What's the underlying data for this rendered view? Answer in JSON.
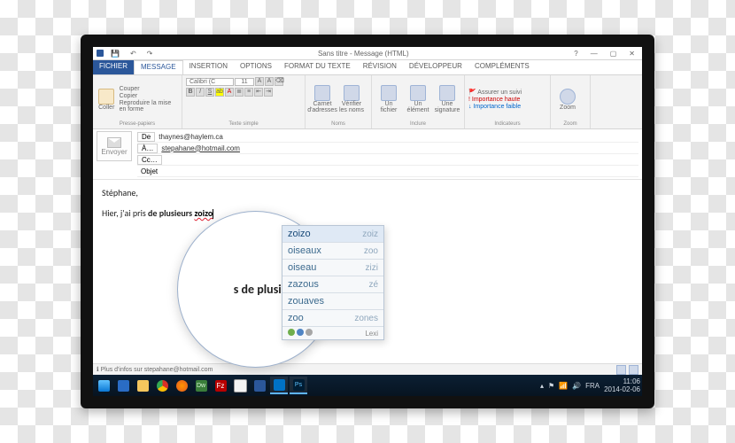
{
  "window": {
    "title": "Sans titre - Message (HTML)"
  },
  "ribbon": {
    "file": "FICHIER",
    "tabs": [
      "MESSAGE",
      "INSERTION",
      "OPTIONS",
      "FORMAT DU TEXTE",
      "RÉVISION",
      "DÉVELOPPEUR",
      "COMPLÉMENTS"
    ],
    "clipboard": {
      "paste": "Coller",
      "cut": "Couper",
      "copy": "Copier",
      "fmt": "Reproduire la mise en forme",
      "title": "Presse-papiers"
    },
    "font": {
      "name": "Calibri (C",
      "size": "11",
      "title": "Texte simple"
    },
    "names": {
      "addressbook": "Carnet\nd'adresses",
      "check": "Vérifier\nles noms",
      "title": "Noms"
    },
    "include": {
      "file": "Un\nfichier",
      "item": "Un\nélément",
      "sig": "Une\nsignature",
      "title": "Inclure"
    },
    "flags": {
      "follow": "Assurer un suivi",
      "high": "Importance haute",
      "low": "Importance faible",
      "title": "Indicateurs"
    },
    "zoom": {
      "label": "Zoom",
      "title": "Zoom"
    }
  },
  "headers": {
    "send": "Envoyer",
    "from_btn": "De",
    "from_val": "thaynes@haylem.ca",
    "to_btn": "À…",
    "to_val": "stepahane@hotmail.com",
    "cc_btn": "Cc…",
    "subject_btn": "Objet"
  },
  "body": {
    "greeting": "Stéphane,",
    "line_pre": "Hier, j'ai pris ",
    "line_bold": "de plusieurs ",
    "mistyped": "zoizo"
  },
  "lens": {
    "bold": "s de plusieurs ",
    "mistyped": "zoizo"
  },
  "suggest": {
    "rows": [
      {
        "l": "zoizo",
        "r": "zoiz"
      },
      {
        "l": "oiseaux",
        "r": "zoo"
      },
      {
        "l": "oiseau",
        "r": "zizi"
      },
      {
        "l": "zazous",
        "r": "zé"
      },
      {
        "l": "zouaves",
        "r": ""
      },
      {
        "l": "zoo",
        "r": "zones"
      }
    ],
    "lexi": "Lexi"
  },
  "status": {
    "info": "Plus d'infos sur stepahane@hotmail.com"
  },
  "taskbar": {
    "lang": "FRA",
    "time": "11:06",
    "date": "2014-02-06"
  }
}
